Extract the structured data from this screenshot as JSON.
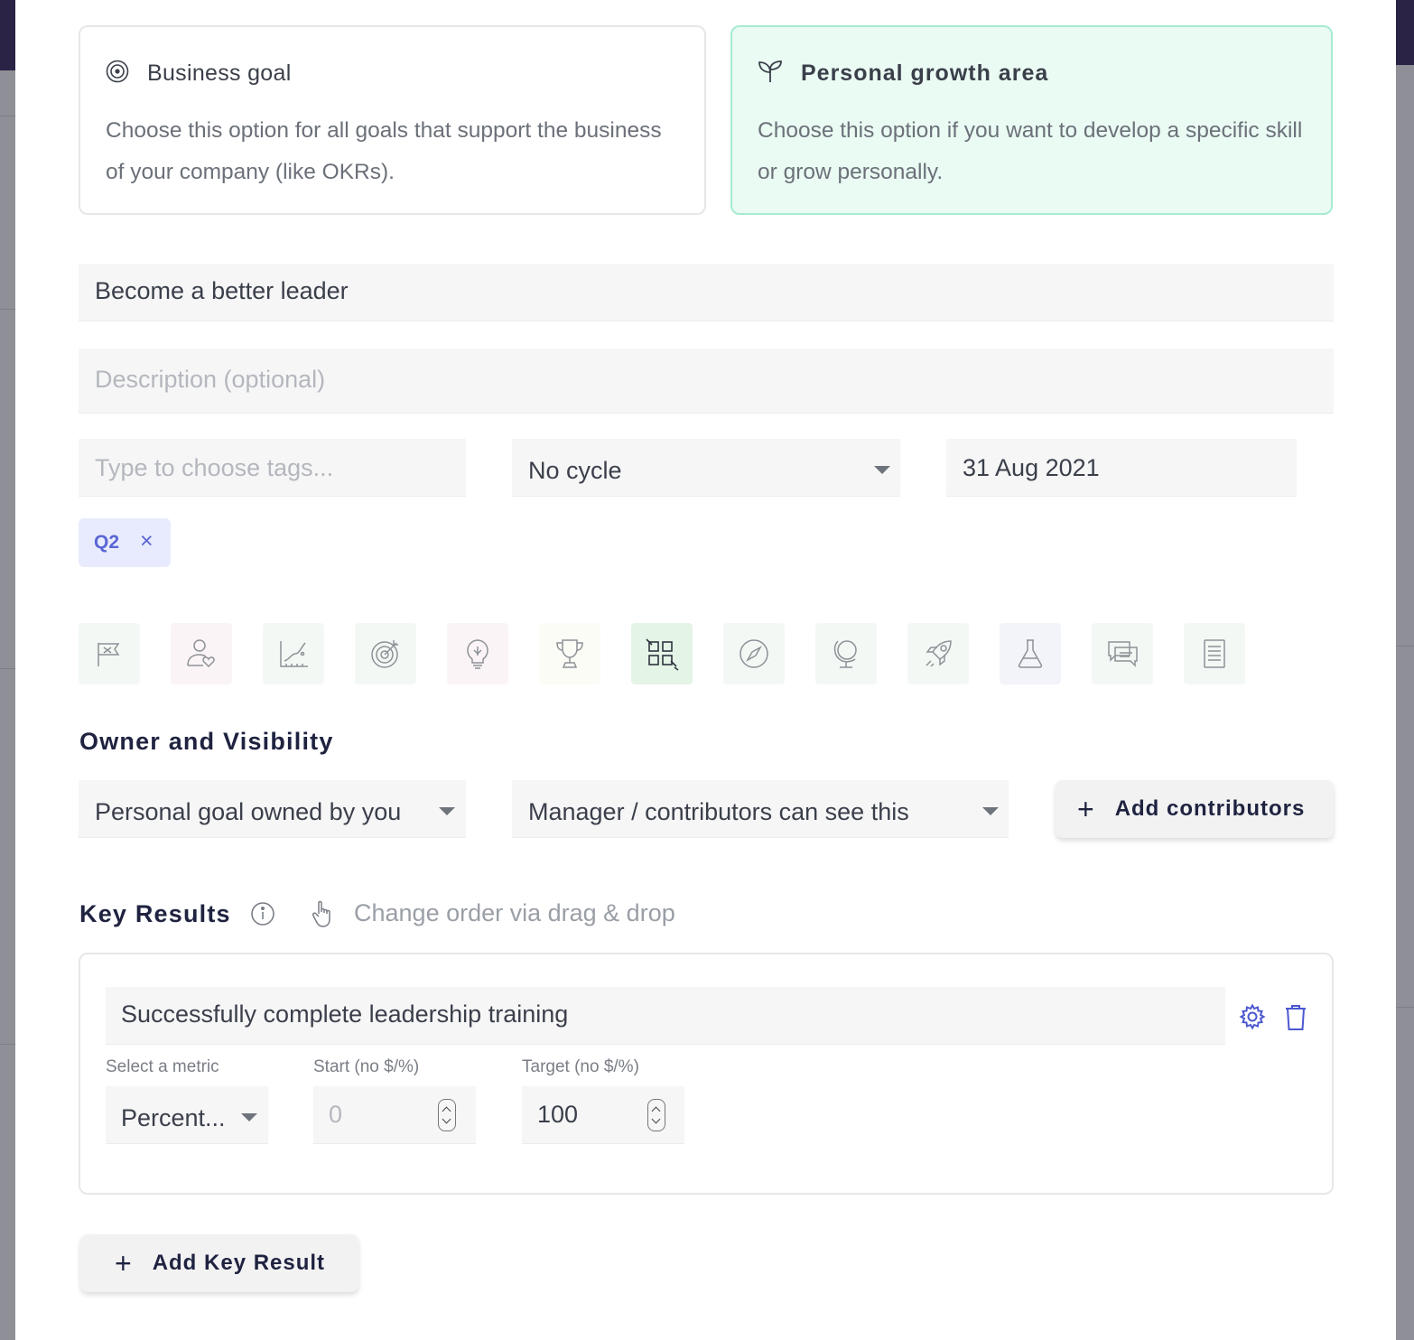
{
  "goal_types": [
    {
      "title": "Business goal",
      "description": "Choose this option for all goals that support the business of your company (like OKRs).",
      "icon": "target-icon",
      "selected": false
    },
    {
      "title": "Personal growth area",
      "description": "Choose this option if you want to develop a specific skill or grow personally.",
      "icon": "sprout-icon",
      "selected": true
    }
  ],
  "form": {
    "title_value": "Become a better leader",
    "description_placeholder": "Description (optional)",
    "tags_placeholder": "Type to choose tags...",
    "cycle_value": "No cycle",
    "due_date": "31 Aug 2021",
    "tags": [
      {
        "label": "Q2",
        "remove": "×"
      }
    ]
  },
  "icon_picker": {
    "selected_index": 6,
    "icons": [
      "flag-icon",
      "person-heart-icon",
      "chart-icon",
      "target-arrow-icon",
      "lightbulb-icon",
      "trophy-icon",
      "puzzle-icon",
      "compass-icon",
      "globe-icon",
      "rocket-icon",
      "flask-icon",
      "chat-icon",
      "document-icon"
    ]
  },
  "owner_visibility": {
    "title": "Owner and Visibility",
    "owner_value": "Personal goal owned by you",
    "visibility_value": "Manager / contributors can see this",
    "add_contributors_label": "Add contributors",
    "plus": "+"
  },
  "key_results": {
    "title": "Key Results",
    "hint": "Change order via drag & drop",
    "items": [
      {
        "title": "Successfully complete leadership training",
        "metric_label": "Select a metric",
        "metric_value": "Percent...",
        "start_label": "Start (no $/%)",
        "start_placeholder": "0",
        "target_label": "Target (no $/%)",
        "target_value": "100"
      }
    ],
    "add_label": "Add Key Result",
    "plus": "+"
  },
  "colors": {
    "accent": "#5a66d6",
    "selected_card_bg": "#eafbf3",
    "selected_card_border": "#a6ecd0",
    "heading": "#1f2340"
  }
}
